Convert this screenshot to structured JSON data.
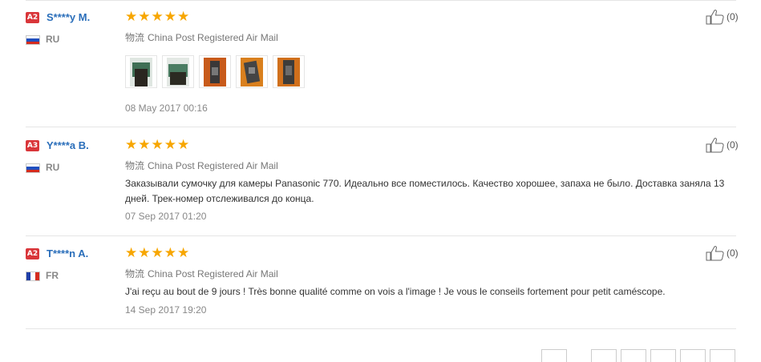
{
  "reviews": [
    {
      "level": "A2",
      "name": "S****y M.",
      "country": "RU",
      "flag": "ru",
      "rating": 5,
      "shipping_label": "物流",
      "shipping": "China Post Registered Air Mail",
      "content": "",
      "date": "08 May 2017 00:16",
      "likes": "(0)",
      "photos": [
        {
          "icon": "product-photo-bag-green",
          "colors": [
            "#3f6f55",
            "#2a2620"
          ]
        },
        {
          "icon": "product-photo-bag-green",
          "colors": [
            "#4a7c62",
            "#2b2a22"
          ]
        },
        {
          "icon": "product-photo-bag-orange",
          "colors": [
            "#c85a1a",
            "#3a3838"
          ]
        },
        {
          "icon": "product-photo-bag-orange",
          "colors": [
            "#d9801e",
            "#444444"
          ]
        },
        {
          "icon": "product-photo-bag-orange",
          "colors": [
            "#d0701c",
            "#3d3c3a"
          ]
        }
      ]
    },
    {
      "level": "A3",
      "name": "Y****a B.",
      "country": "RU",
      "flag": "ru",
      "rating": 5,
      "shipping_label": "物流",
      "shipping": "China Post Registered Air Mail",
      "content": "Заказывали сумочку для камеры Panasonic 770. Идеально все поместилось. Качество хорошее, запаха не было. Доставка заняла 13 дней. Трек-номер отслеживался до конца.",
      "date": "07 Sep 2017 01:20",
      "likes": "(0)",
      "photos": []
    },
    {
      "level": "A2",
      "name": "T****n A.",
      "country": "FR",
      "flag": "fr",
      "rating": 5,
      "shipping_label": "物流",
      "shipping": "China Post Registered Air Mail",
      "content": "J'ai reçu au bout de 9 jours ! Très bonne qualité comme on vois a l'image ! Je vous le conseils fortement pour petit caméscope.",
      "date": "14 Sep 2017 19:20",
      "likes": "(0)",
      "photos": []
    }
  ],
  "colors": {
    "star": "#f7a600",
    "badge": "#d9363a",
    "username": "#2a6eba",
    "flag_ru": [
      "#ffffff",
      "#1f4fbf",
      "#d52b1e"
    ],
    "flag_fr": [
      "#1f3fa8",
      "#ffffff",
      "#d52b1e"
    ]
  },
  "icons": {
    "like": "thumbs-up-icon",
    "star": "star-icon"
  }
}
